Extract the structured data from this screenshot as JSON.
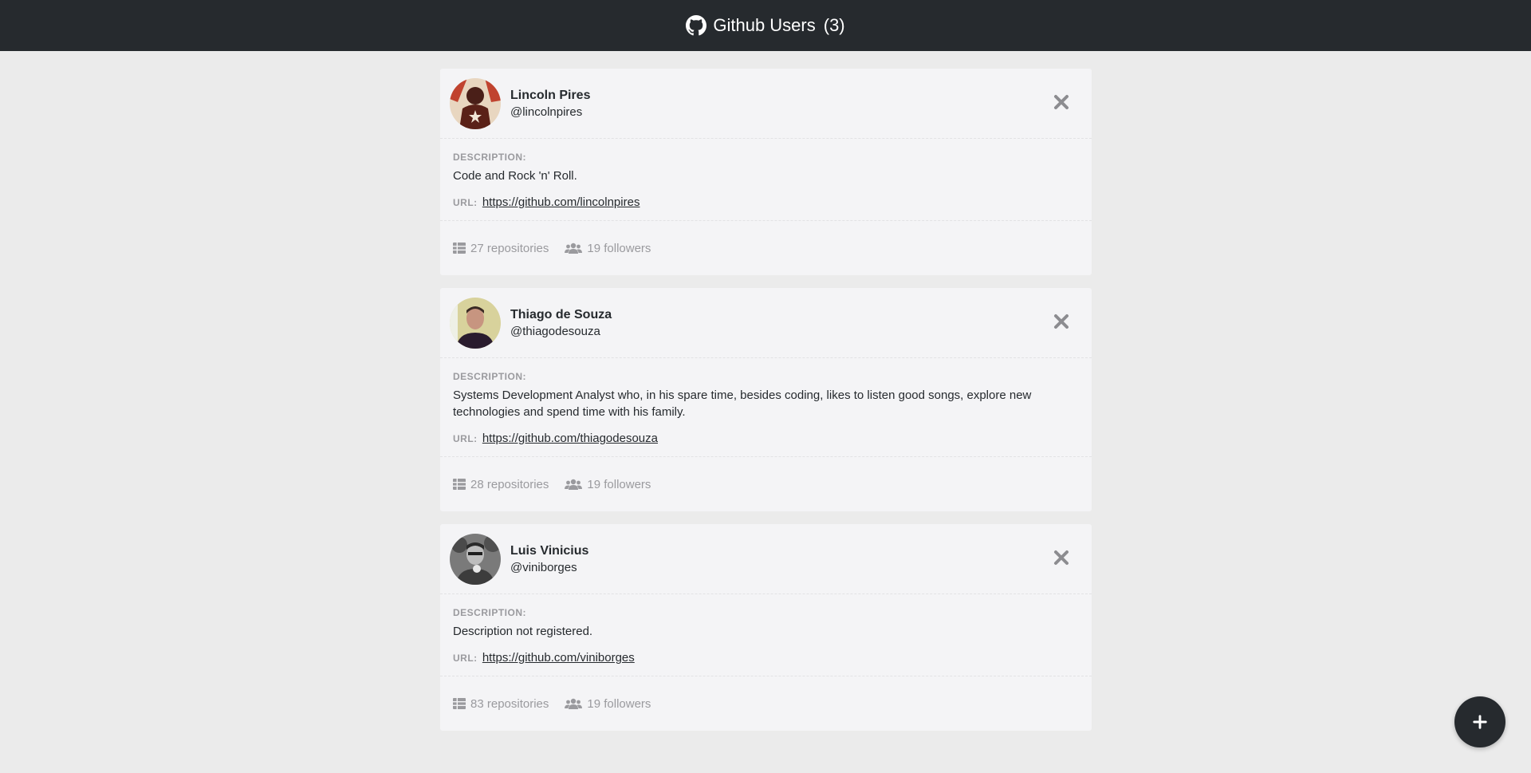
{
  "header": {
    "title": "Github Users",
    "count": "(3)",
    "icon": "github-icon"
  },
  "labels": {
    "description": "DESCRIPTION:",
    "url": "URL:"
  },
  "users": [
    {
      "name": "Lincoln Pires",
      "login": "@lincolnpires",
      "description": "Code and Rock 'n' Roll.",
      "url": "https://github.com/lincolnpires",
      "repositories": "27 repositories",
      "followers": "19 followers",
      "avatar_color": "#b04a3a"
    },
    {
      "name": "Thiago de Souza",
      "login": "@thiagodesouza",
      "description": "Systems Development Analyst who, in his spare time, besides coding, likes to listen good songs, explore new technologies and spend time with his family.",
      "url": "https://github.com/thiagodesouza",
      "repositories": "28 repositories",
      "followers": "19 followers",
      "avatar_color": "#c9c08a"
    },
    {
      "name": "Luis Vinicius",
      "login": "@viniborges",
      "description": "Description not registered.",
      "url": "https://github.com/viniborges",
      "repositories": "83 repositories",
      "followers": "19 followers",
      "avatar_color": "#5a5a5a"
    }
  ],
  "fab": {
    "icon": "plus-icon"
  },
  "colors": {
    "topbar": "#262a2e",
    "background": "#ebebeb",
    "card": "#f4f4f6",
    "muted": "#9a9a9e"
  }
}
